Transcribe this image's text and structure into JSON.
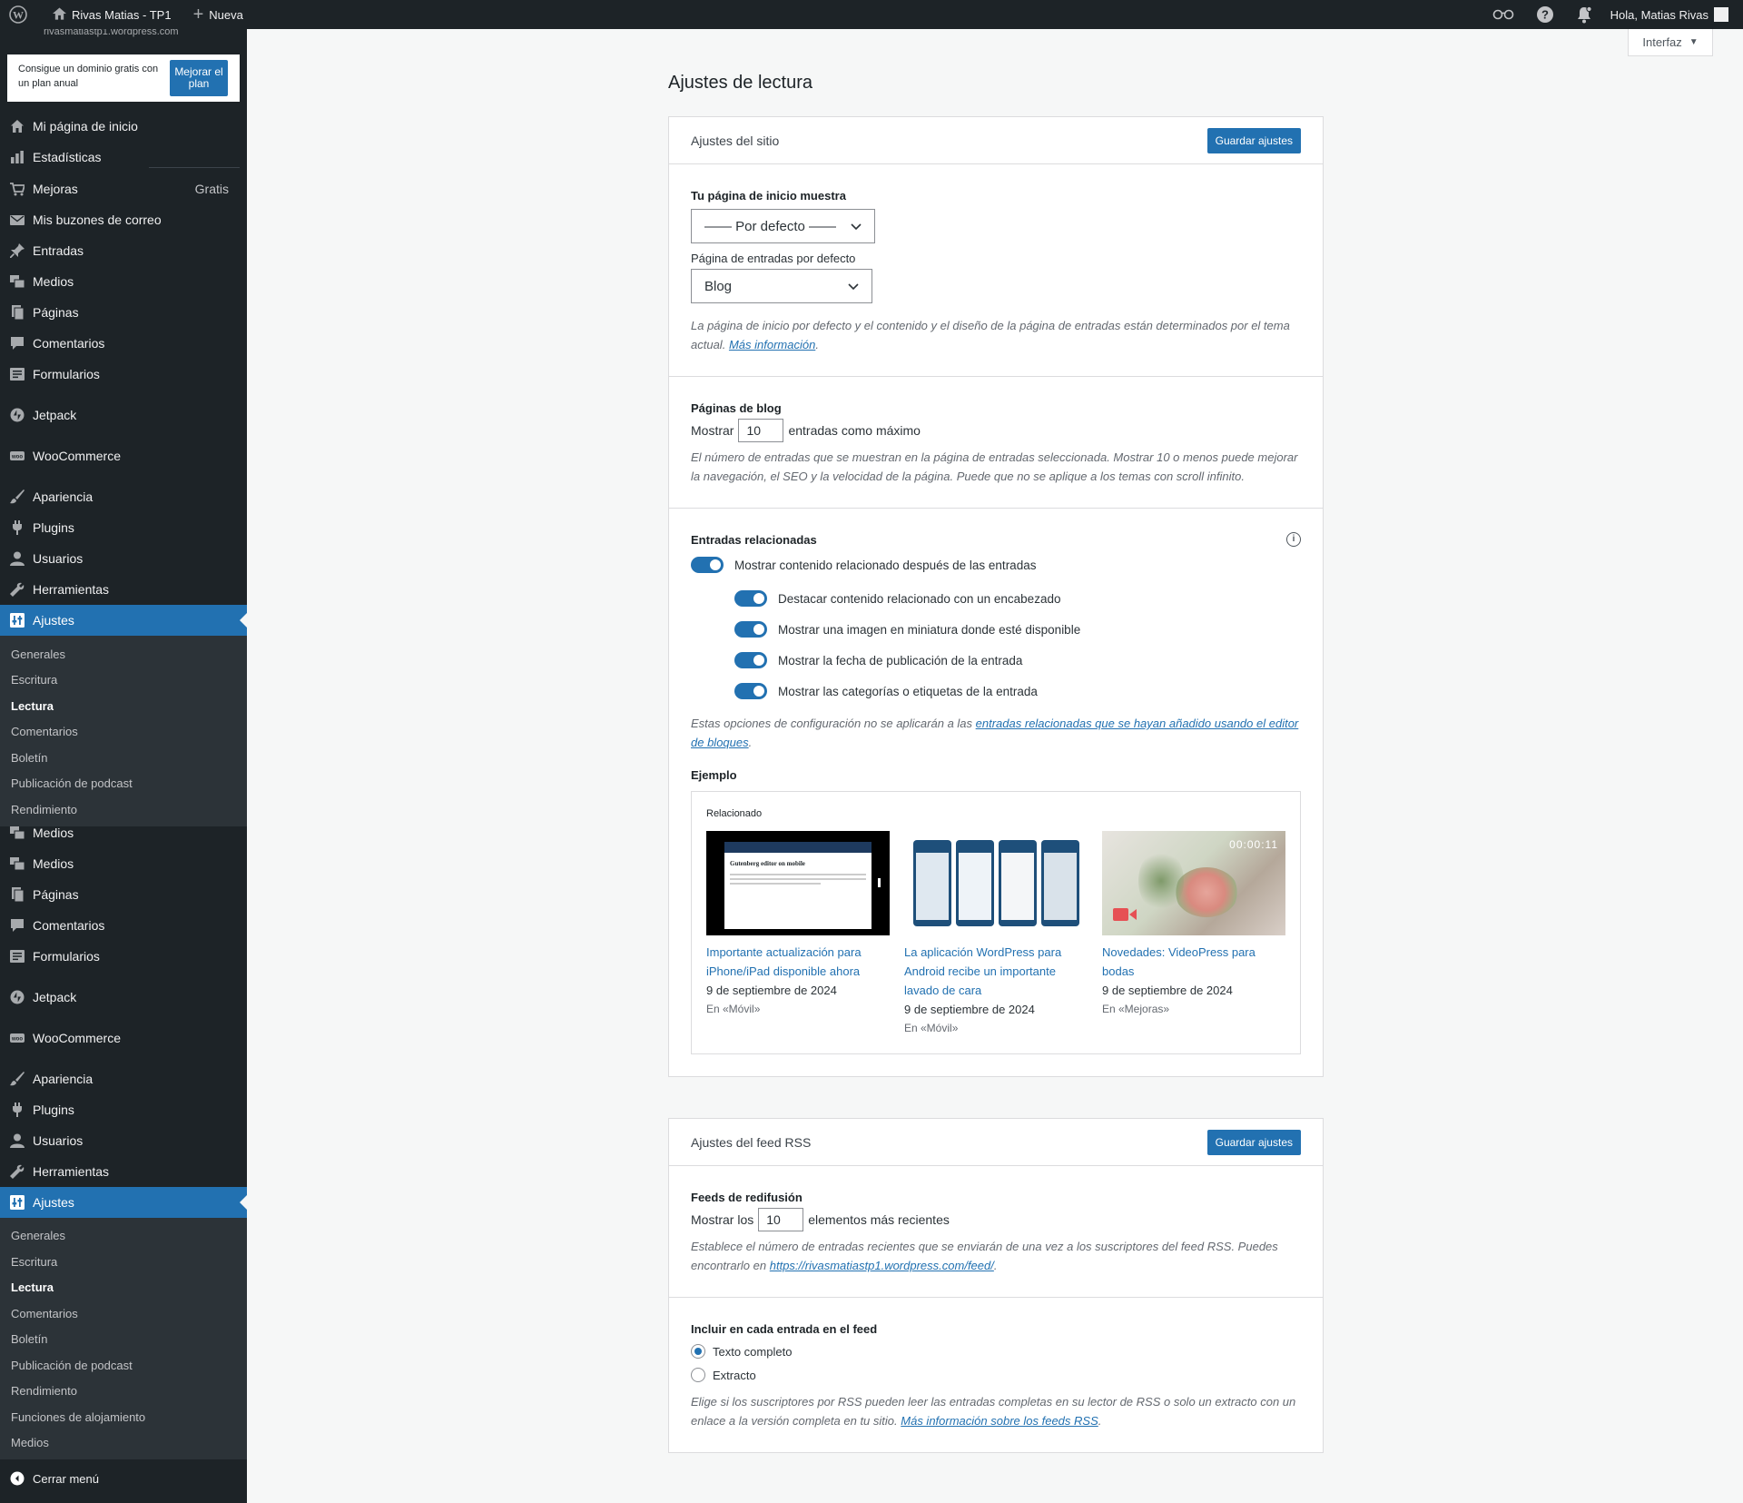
{
  "adminbar": {
    "site_name": "Rivas Matias - TP1",
    "new_label": "Nueva",
    "greeting": "Hola, Matias Rivas"
  },
  "sidebar": {
    "site_url": "rivasmatiastp1.wordpress.com",
    "promo_text": "Consigue un dominio gratis con un plan anual",
    "promo_button": "Mejorar el plan",
    "menu_top": [
      {
        "label": "Mi página de inicio",
        "icon": "home-icon"
      },
      {
        "label": "Estadísticas",
        "icon": "stats-icon"
      },
      {
        "label": "Mejoras",
        "icon": "cart-icon",
        "badge": "Gratis"
      },
      {
        "label": "Mis buzones de correo",
        "icon": "mail-icon"
      },
      {
        "label": "Entradas",
        "icon": "pin-icon"
      },
      {
        "label": "Medios",
        "icon": "media-icon"
      },
      {
        "label": "Páginas",
        "icon": "pages-icon"
      },
      {
        "label": "Comentarios",
        "icon": "comment-icon"
      },
      {
        "label": "Formularios",
        "icon": "forms-icon"
      },
      {
        "label": "Jetpack",
        "icon": "jetpack-icon"
      },
      {
        "label": "WooCommerce",
        "icon": "woo-icon"
      },
      {
        "label": "Apariencia",
        "icon": "brush-icon"
      },
      {
        "label": "Plugins",
        "icon": "plugin-icon"
      },
      {
        "label": "Usuarios",
        "icon": "user-icon"
      },
      {
        "label": "Herramientas",
        "icon": "wrench-icon"
      },
      {
        "label": "Ajustes",
        "icon": "settings-icon"
      }
    ],
    "submenu_1": [
      "Generales",
      "Escritura",
      "Lectura",
      "Comentarios",
      "Boletín",
      "Publicación de podcast",
      "Rendimiento"
    ],
    "menu_mid": [
      {
        "label": "Medios"
      },
      {
        "label": "Medios"
      },
      {
        "label": "Páginas"
      },
      {
        "label": "Comentarios"
      },
      {
        "label": "Formularios"
      },
      {
        "label": "Jetpack"
      },
      {
        "label": "WooCommerce"
      },
      {
        "label": "Apariencia"
      },
      {
        "label": "Plugins"
      },
      {
        "label": "Usuarios"
      },
      {
        "label": "Herramientas"
      },
      {
        "label": "Ajustes"
      }
    ],
    "submenu_2": [
      "Generales",
      "Escritura",
      "Lectura",
      "Comentarios",
      "Boletín",
      "Publicación de podcast",
      "Rendimiento",
      "Funciones de alojamiento",
      "Medios"
    ],
    "collapse_label": "Cerrar menú"
  },
  "interfaz_label": "Interfaz",
  "page_title": "Ajustes de lectura",
  "site_settings": {
    "header": "Ajustes del sitio",
    "save": "Guardar ajustes",
    "homepage_label": "Tu página de inicio muestra",
    "homepage_value": "—— Por defecto ——",
    "posts_page_label": "Página de entradas por defecto",
    "posts_page_value": "Blog",
    "homepage_help": "La página de inicio por defecto y el contenido y el diseño de la página de entradas están determinados por el tema actual.",
    "homepage_help_link": "Más información",
    "blog_pages_label": "Páginas de blog",
    "show_label": "Mostrar",
    "posts_per_page": "10",
    "posts_suffix": "entradas como máximo",
    "blog_help": "El número de entradas que se muestran en la página de entradas seleccionada. Mostrar 10 o menos puede mejorar la navegación, el SEO y la velocidad de la página. Puede que no se aplique a los temas con scroll infinito.",
    "related_label": "Entradas relacionadas",
    "related_main": "Mostrar contenido relacionado después de las entradas",
    "related_options": [
      "Destacar contenido relacionado con un encabezado",
      "Mostrar una imagen en miniatura donde esté disponible",
      "Mostrar la fecha de publicación de la entrada",
      "Mostrar las categorías o etiquetas de la entrada"
    ],
    "related_help": "Estas opciones de configuración no se aplicarán a las",
    "related_help_link": "entradas relacionadas que se hayan añadido usando el editor de bloques",
    "example_label": "Ejemplo",
    "example_related": "Relacionado",
    "example_posts": [
      {
        "title": "Importante actualización para iPhone/iPad disponible ahora",
        "date": "9 de septiembre de 2024",
        "category": "En «Móvil»",
        "thumb_title": "Gutenberg editor on mobile"
      },
      {
        "title": "La aplicación WordPress para Android recibe un importante lavado de cara",
        "date": "9 de septiembre de 2024",
        "category": "En «Móvil»"
      },
      {
        "title": "Novedades: VideoPress para bodas",
        "date": "9 de septiembre de 2024",
        "category": "En «Mejoras»",
        "video_time": "00:00:11"
      }
    ]
  },
  "rss_settings": {
    "header": "Ajustes del feed RSS",
    "save": "Guardar ajustes",
    "feeds_label": "Feeds de redifusión",
    "show_label": "Mostrar los",
    "items_count": "10",
    "items_suffix": "elementos más recientes",
    "feeds_help": "Establece el número de entradas recientes que se enviarán de una vez a los suscriptores del feed RSS. Puedes encontrarlo en",
    "feed_url": "https://rivasmatiastp1.wordpress.com/feed/",
    "include_label": "Incluir en cada entrada en el feed",
    "option_full": "Texto completo",
    "option_excerpt": "Extracto",
    "include_help": "Elige si los suscriptores por RSS pueden leer las entradas completas en su lector de RSS o solo un extracto con un enlace a la versión completa en tu sitio.",
    "include_help_link": "Más información sobre los feeds RSS"
  }
}
